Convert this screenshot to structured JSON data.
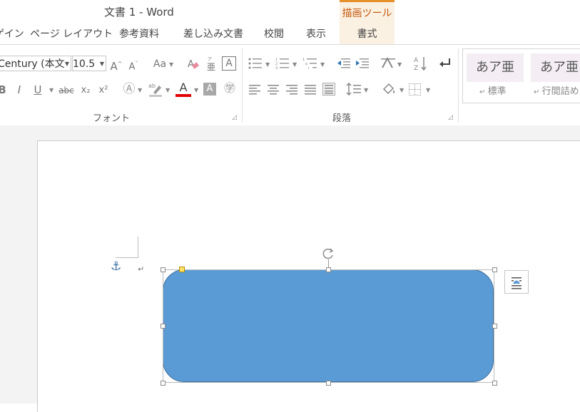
{
  "titlebar": {
    "title": "文書 1 - Word",
    "contextual_label": "描画ツール"
  },
  "tabs": [
    "ゲイン",
    "ページ レイアウト",
    "参考資料",
    "差し込み文書",
    "校閲",
    "表示",
    "書式"
  ],
  "ribbon": {
    "font_group_label": "フォント",
    "paragraph_group_label": "段落",
    "font_name": "Century (本文",
    "font_size": "10.5",
    "font_case_label": "Aa",
    "bold": "B",
    "italic": "I",
    "underline": "U",
    "strike": "abc",
    "subscript": "x₂",
    "superscript": "x²",
    "font_color_label": "A",
    "styles": [
      {
        "preview": "あア亜",
        "name": "標準"
      },
      {
        "preview": "あア亜",
        "name": "行間詰め"
      }
    ]
  },
  "colors": {
    "accent": "#e6912c",
    "shape_fill": "#5b9bd5",
    "shape_border": "#41719c",
    "font_color_bar": "#e00000"
  },
  "icons": [
    "grow-font-icon",
    "shrink-font-icon",
    "clear-format-icon",
    "phonetic-guide-icon",
    "char-border-icon",
    "bullets-icon",
    "numbering-icon",
    "multilevel-icon",
    "decrease-indent-icon",
    "increase-indent-icon",
    "text-direction-icon",
    "sort-icon",
    "show-marks-icon",
    "align-left-icon",
    "align-center-icon",
    "align-right-icon",
    "justify-icon",
    "distributed-icon",
    "line-spacing-icon",
    "shading-icon",
    "borders-icon",
    "anchor-icon",
    "rotate-icon",
    "layout-options-icon"
  ]
}
